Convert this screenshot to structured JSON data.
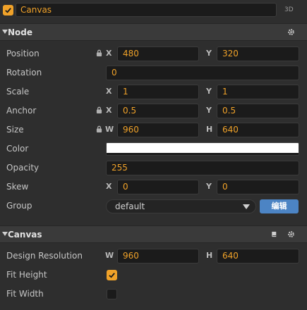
{
  "header": {
    "enabled": true,
    "node_name": "Canvas",
    "badge": "3D"
  },
  "node_section": {
    "title": "Node",
    "position": {
      "label": "Position",
      "x_axis": "X",
      "x": "480",
      "y_axis": "Y",
      "y": "320"
    },
    "rotation": {
      "label": "Rotation",
      "value": "0"
    },
    "scale": {
      "label": "Scale",
      "x_axis": "X",
      "x": "1",
      "y_axis": "Y",
      "y": "1"
    },
    "anchor": {
      "label": "Anchor",
      "x_axis": "X",
      "x": "0.5",
      "y_axis": "Y",
      "y": "0.5"
    },
    "size": {
      "label": "Size",
      "w_axis": "W",
      "w": "960",
      "h_axis": "H",
      "h": "640"
    },
    "color": {
      "label": "Color",
      "value": "#ffffff"
    },
    "opacity": {
      "label": "Opacity",
      "value": "255"
    },
    "skew": {
      "label": "Skew",
      "x_axis": "X",
      "x": "0",
      "y_axis": "Y",
      "y": "0"
    },
    "group": {
      "label": "Group",
      "selected": "default",
      "edit_button": "编辑"
    }
  },
  "canvas_section": {
    "title": "Canvas",
    "design_resolution": {
      "label": "Design Resolution",
      "w_axis": "W",
      "w": "960",
      "h_axis": "H",
      "h": "640"
    },
    "fit_height": {
      "label": "Fit Height",
      "checked": true
    },
    "fit_width": {
      "label": "Fit Width",
      "checked": false
    }
  },
  "colors": {
    "accent": "#f0a229",
    "panel": "#2e2e2e",
    "header": "#3a3a3a",
    "field": "#1b1b1b",
    "button": "#4c84c4"
  }
}
